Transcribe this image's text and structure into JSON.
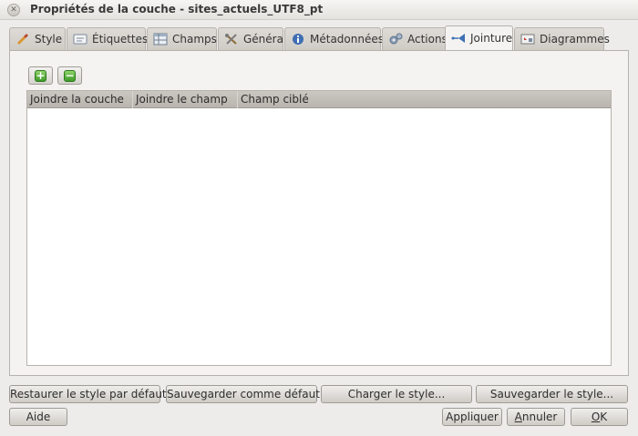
{
  "window": {
    "title": "Propriétés de la couche - sites_actuels_UTF8_pt"
  },
  "tabs": [
    {
      "label": "Style",
      "icon": "brush-icon"
    },
    {
      "label": "Étiquettes",
      "icon": "label-icon"
    },
    {
      "label": "Champs",
      "icon": "table-icon"
    },
    {
      "label": "Général",
      "icon": "tools-icon"
    },
    {
      "label": "Métadonnées",
      "icon": "info-icon"
    },
    {
      "label": "Actions",
      "icon": "gears-icon"
    },
    {
      "label": "Jointure",
      "icon": "join-icon",
      "active": true
    },
    {
      "label": "Diagrammes",
      "icon": "diagram-icon"
    }
  ],
  "join_panel": {
    "add_symbol": "+",
    "remove_symbol": "−",
    "columns": [
      "Joindre la couche",
      "Joindre le champ",
      "Champ ciblé"
    ],
    "rows": []
  },
  "buttons": {
    "restore_default": "Restaurer le style par défaut",
    "save_default": "Sauvegarder comme défaut",
    "load_style": "Charger le style...",
    "save_style": "Sauvegarder le style...",
    "help": "Aide",
    "apply": "Appliquer",
    "cancel_first": "A",
    "cancel_rest": "nnuler",
    "ok_first": "O",
    "ok_rest": "K"
  }
}
